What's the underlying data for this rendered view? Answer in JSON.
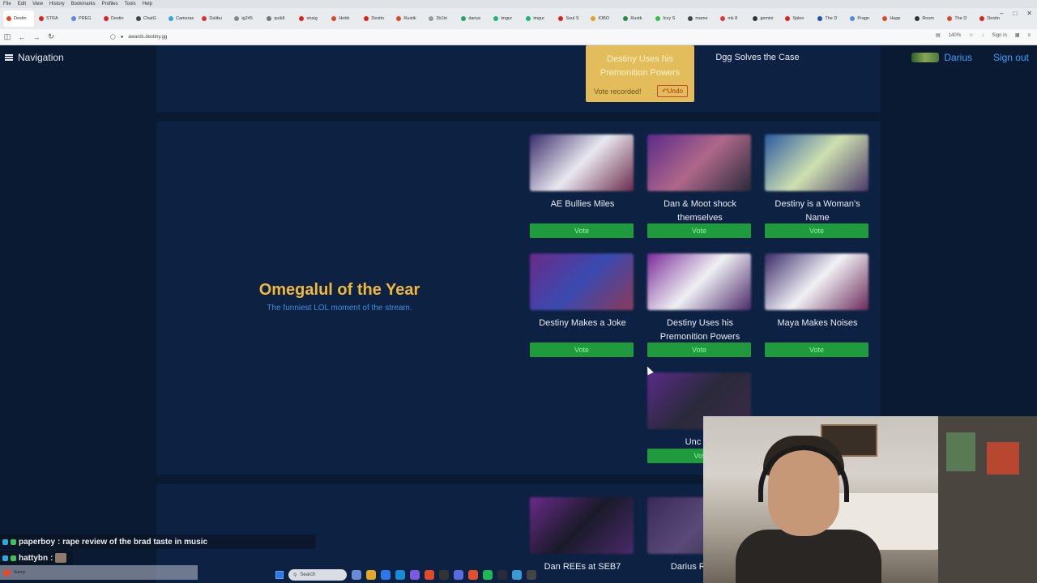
{
  "browser": {
    "menu": [
      "File",
      "Edit",
      "View",
      "History",
      "Bookmarks",
      "Profiles",
      "Tools",
      "Help"
    ],
    "tabs": [
      {
        "label": "Destin",
        "color": "#e24a2a",
        "active": true
      },
      {
        "label": "STRA",
        "color": "#e02020"
      },
      {
        "label": "PREG",
        "color": "#5a87e0"
      },
      {
        "label": "Destin",
        "color": "#e02020"
      },
      {
        "label": "ChatG",
        "color": "#444444"
      },
      {
        "label": "Cameras",
        "color": "#2fa7e0"
      },
      {
        "label": "Dalibu",
        "color": "#e03030"
      },
      {
        "label": "ig245",
        "color": "#888888"
      },
      {
        "label": "quik8",
        "color": "#777777"
      },
      {
        "label": "straig",
        "color": "#e02020"
      },
      {
        "label": "Hobb",
        "color": "#d94a2a"
      },
      {
        "label": "Destin",
        "color": "#e02020"
      },
      {
        "label": "Rustik",
        "color": "#d94a2a"
      },
      {
        "label": "2b1bi",
        "color": "#999999"
      },
      {
        "label": "darius",
        "color": "#25a36b"
      },
      {
        "label": "imgur",
        "color": "#1bb76e"
      },
      {
        "label": "imgur",
        "color": "#1bb76e"
      },
      {
        "label": "Soul S",
        "color": "#e02020"
      },
      {
        "label": "IOBO",
        "color": "#e0a020"
      },
      {
        "label": "Rustk",
        "color": "#2a8a4a"
      },
      {
        "label": "Iccy S",
        "color": "#2fbf4a"
      },
      {
        "label": "mame",
        "color": "#444444"
      },
      {
        "label": "mk 8",
        "color": "#d93a3a"
      },
      {
        "label": "gemini",
        "color": "#333333"
      },
      {
        "label": "Splen",
        "color": "#e02020"
      },
      {
        "label": "The D",
        "color": "#2050b0"
      },
      {
        "label": "Pragn",
        "color": "#5a87e0"
      },
      {
        "label": "Happ",
        "color": "#d94a2a"
      },
      {
        "label": "Room",
        "color": "#333333"
      },
      {
        "label": "The D",
        "color": "#d94a2a"
      },
      {
        "label": "Destin",
        "color": "#e02020"
      }
    ],
    "url": "awards.destiny.gg",
    "zoom": "140%",
    "sign_in": "Sign in"
  },
  "header": {
    "nav_label": "Navigation",
    "username": "Darius",
    "sign_out": "Sign out"
  },
  "previous_category": {
    "voted_title": "Destiny Uses his Premonition Powers",
    "vote_recorded": "Vote recorded!",
    "undo": "Undo",
    "other_nominee": "Dgg Solves the Case"
  },
  "category": {
    "title": "Omegalul of the Year",
    "description": "The funniest LOL moment of the stream.",
    "nominees": [
      {
        "name": "AE Bullies Miles",
        "vote": "Vote",
        "thumb_colors": [
          "#3a2b6b",
          "#e9e9f0",
          "#6b2a4a"
        ]
      },
      {
        "name": "Dan & Moot shock themselves",
        "vote": "Vote",
        "thumb_colors": [
          "#5b2a8a",
          "#b0688a",
          "#2a2a3a"
        ]
      },
      {
        "name": "Destiny is a Woman's Name",
        "vote": "Vote",
        "thumb_colors": [
          "#2a5aa0",
          "#cfe0b0",
          "#4a3a6a"
        ]
      },
      {
        "name": "Destiny Makes a Joke",
        "vote": "Vote",
        "thumb_colors": [
          "#6a2a8a",
          "#3a4ab0",
          "#8a3a5a"
        ]
      },
      {
        "name": "Destiny Uses his Premonition Powers",
        "vote": "Vote",
        "thumb_colors": [
          "#7a2a9a",
          "#f0f0f4",
          "#4a2a6a"
        ]
      },
      {
        "name": "Maya Makes Noises",
        "vote": "Vote",
        "thumb_colors": [
          "#3a2a6a",
          "#f2f2f6",
          "#6a2a5a"
        ]
      },
      {
        "name": "Unc Ra",
        "vote": "Vot",
        "thumb_colors": [
          "#5a2a8a",
          "#2a2a3a",
          "#3a2a4a"
        ]
      }
    ]
  },
  "next_category": {
    "nominees": [
      {
        "name": "Dan REEs at SEB7",
        "thumb_colors": [
          "#6a2a8a",
          "#1a1a2a",
          "#4a2a6a"
        ]
      },
      {
        "name": "Darius REEs a",
        "thumb_colors": [
          "#3a2a5a",
          "#5a4a7a",
          "#2a2a3a"
        ]
      }
    ]
  },
  "chat": [
    {
      "user": "paperboy",
      "message": ": rape review of the brad taste in music"
    },
    {
      "user": "hattybn",
      "message": ":"
    }
  ],
  "taskbar": {
    "weather": "Sunny",
    "search": "Search"
  }
}
